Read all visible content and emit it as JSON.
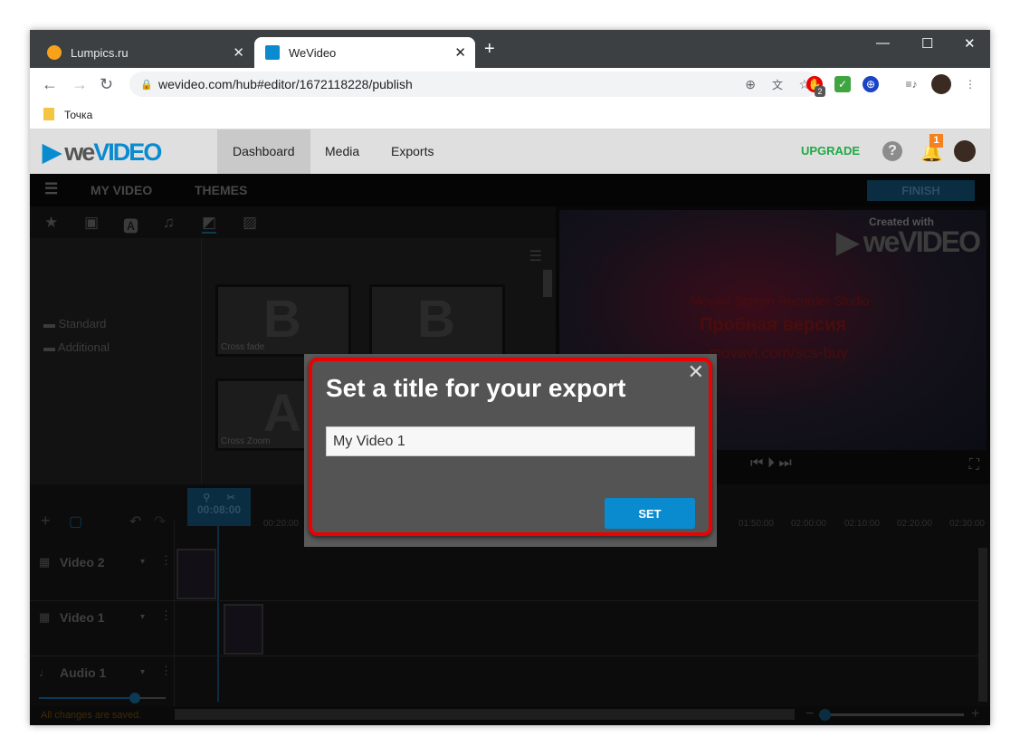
{
  "browser": {
    "tabs": [
      {
        "label": "Lumpics.ru"
      },
      {
        "label": "WeVideo"
      }
    ],
    "url": "wevideo.com/hub#editor/1672118228/publish",
    "bookmark": "Точка",
    "ext_badge": "2"
  },
  "header": {
    "logo": "weVIDEO",
    "nav": [
      "Dashboard",
      "Media",
      "Exports"
    ],
    "upgrade": "UPGRADE",
    "notif_count": "1"
  },
  "editor": {
    "menu": [
      "MY VIDEO",
      "THEMES"
    ],
    "finish": "FINISH"
  },
  "library": {
    "folders": [
      "Standard",
      "Additional"
    ],
    "transitions": [
      "Cross fade",
      "Cross Zoom"
    ]
  },
  "preview": {
    "watermark": "Created with",
    "trial_line1": "Movavi Screen Recorder Studio",
    "trial_line2": "Пробная версия",
    "trial_line3": "movavi.com/scs-buy"
  },
  "timeline": {
    "playhead": "00:08:00",
    "ticks": [
      "00:20:00",
      "01:50:00",
      "02:00:00",
      "02:10:00",
      "02:20:00",
      "02:30:00"
    ],
    "tracks": [
      "Video 2",
      "Video 1",
      "Audio 1"
    ],
    "audio_volume": 0.75,
    "status": "All changes are saved."
  },
  "modal": {
    "title": "Set a title for your export",
    "input_value": "My Video 1",
    "button": "SET"
  },
  "colors": {
    "accent": "#0a8bd0",
    "upgrade": "#1faa45",
    "highlight": "#e00000"
  }
}
